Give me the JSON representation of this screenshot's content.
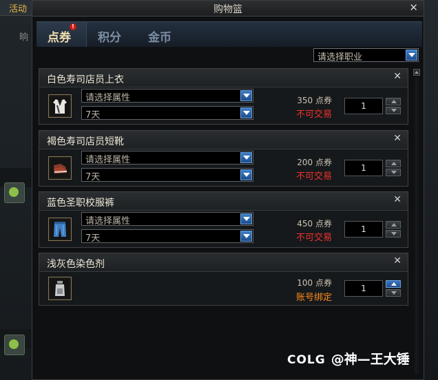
{
  "background": {
    "left_tab": "活动",
    "left_tab2": "晌"
  },
  "window": {
    "title": "购物篮"
  },
  "tabs": [
    {
      "label": "点券",
      "active": true,
      "alert": "!"
    },
    {
      "label": "积分",
      "active": false
    },
    {
      "label": "金币",
      "active": false
    }
  ],
  "job_select": {
    "value": "请选择职业"
  },
  "items": [
    {
      "name": "白色寿司店员上衣",
      "attribute_placeholder": "请选择属性",
      "duration": "7天",
      "price": "350 点券",
      "trade": "不可交易",
      "quantity": "1",
      "icon": "shirt-icon"
    },
    {
      "name": "褐色寿司店员短靴",
      "attribute_placeholder": "请选择属性",
      "duration": "7天",
      "price": "200 点券",
      "trade": "不可交易",
      "quantity": "1",
      "icon": "boots-icon"
    },
    {
      "name": "蓝色圣职校服裤",
      "attribute_placeholder": "请选择属性",
      "duration": "7天",
      "price": "450 点券",
      "trade": "不可交易",
      "quantity": "1",
      "icon": "pants-icon"
    },
    {
      "name": "浅灰色染色剂",
      "price": "100 点券",
      "trade": "账号绑定",
      "quantity": "1",
      "icon": "dye-bottle-icon"
    }
  ],
  "watermark": {
    "logo": "COLG",
    "text": "@神—王大锤"
  },
  "colors": {
    "untradeable": "#f0322c",
    "account_bound": "#ff8a1c",
    "active_tab": "#f0e0b0",
    "inactive_tab": "#7c8ea5"
  }
}
